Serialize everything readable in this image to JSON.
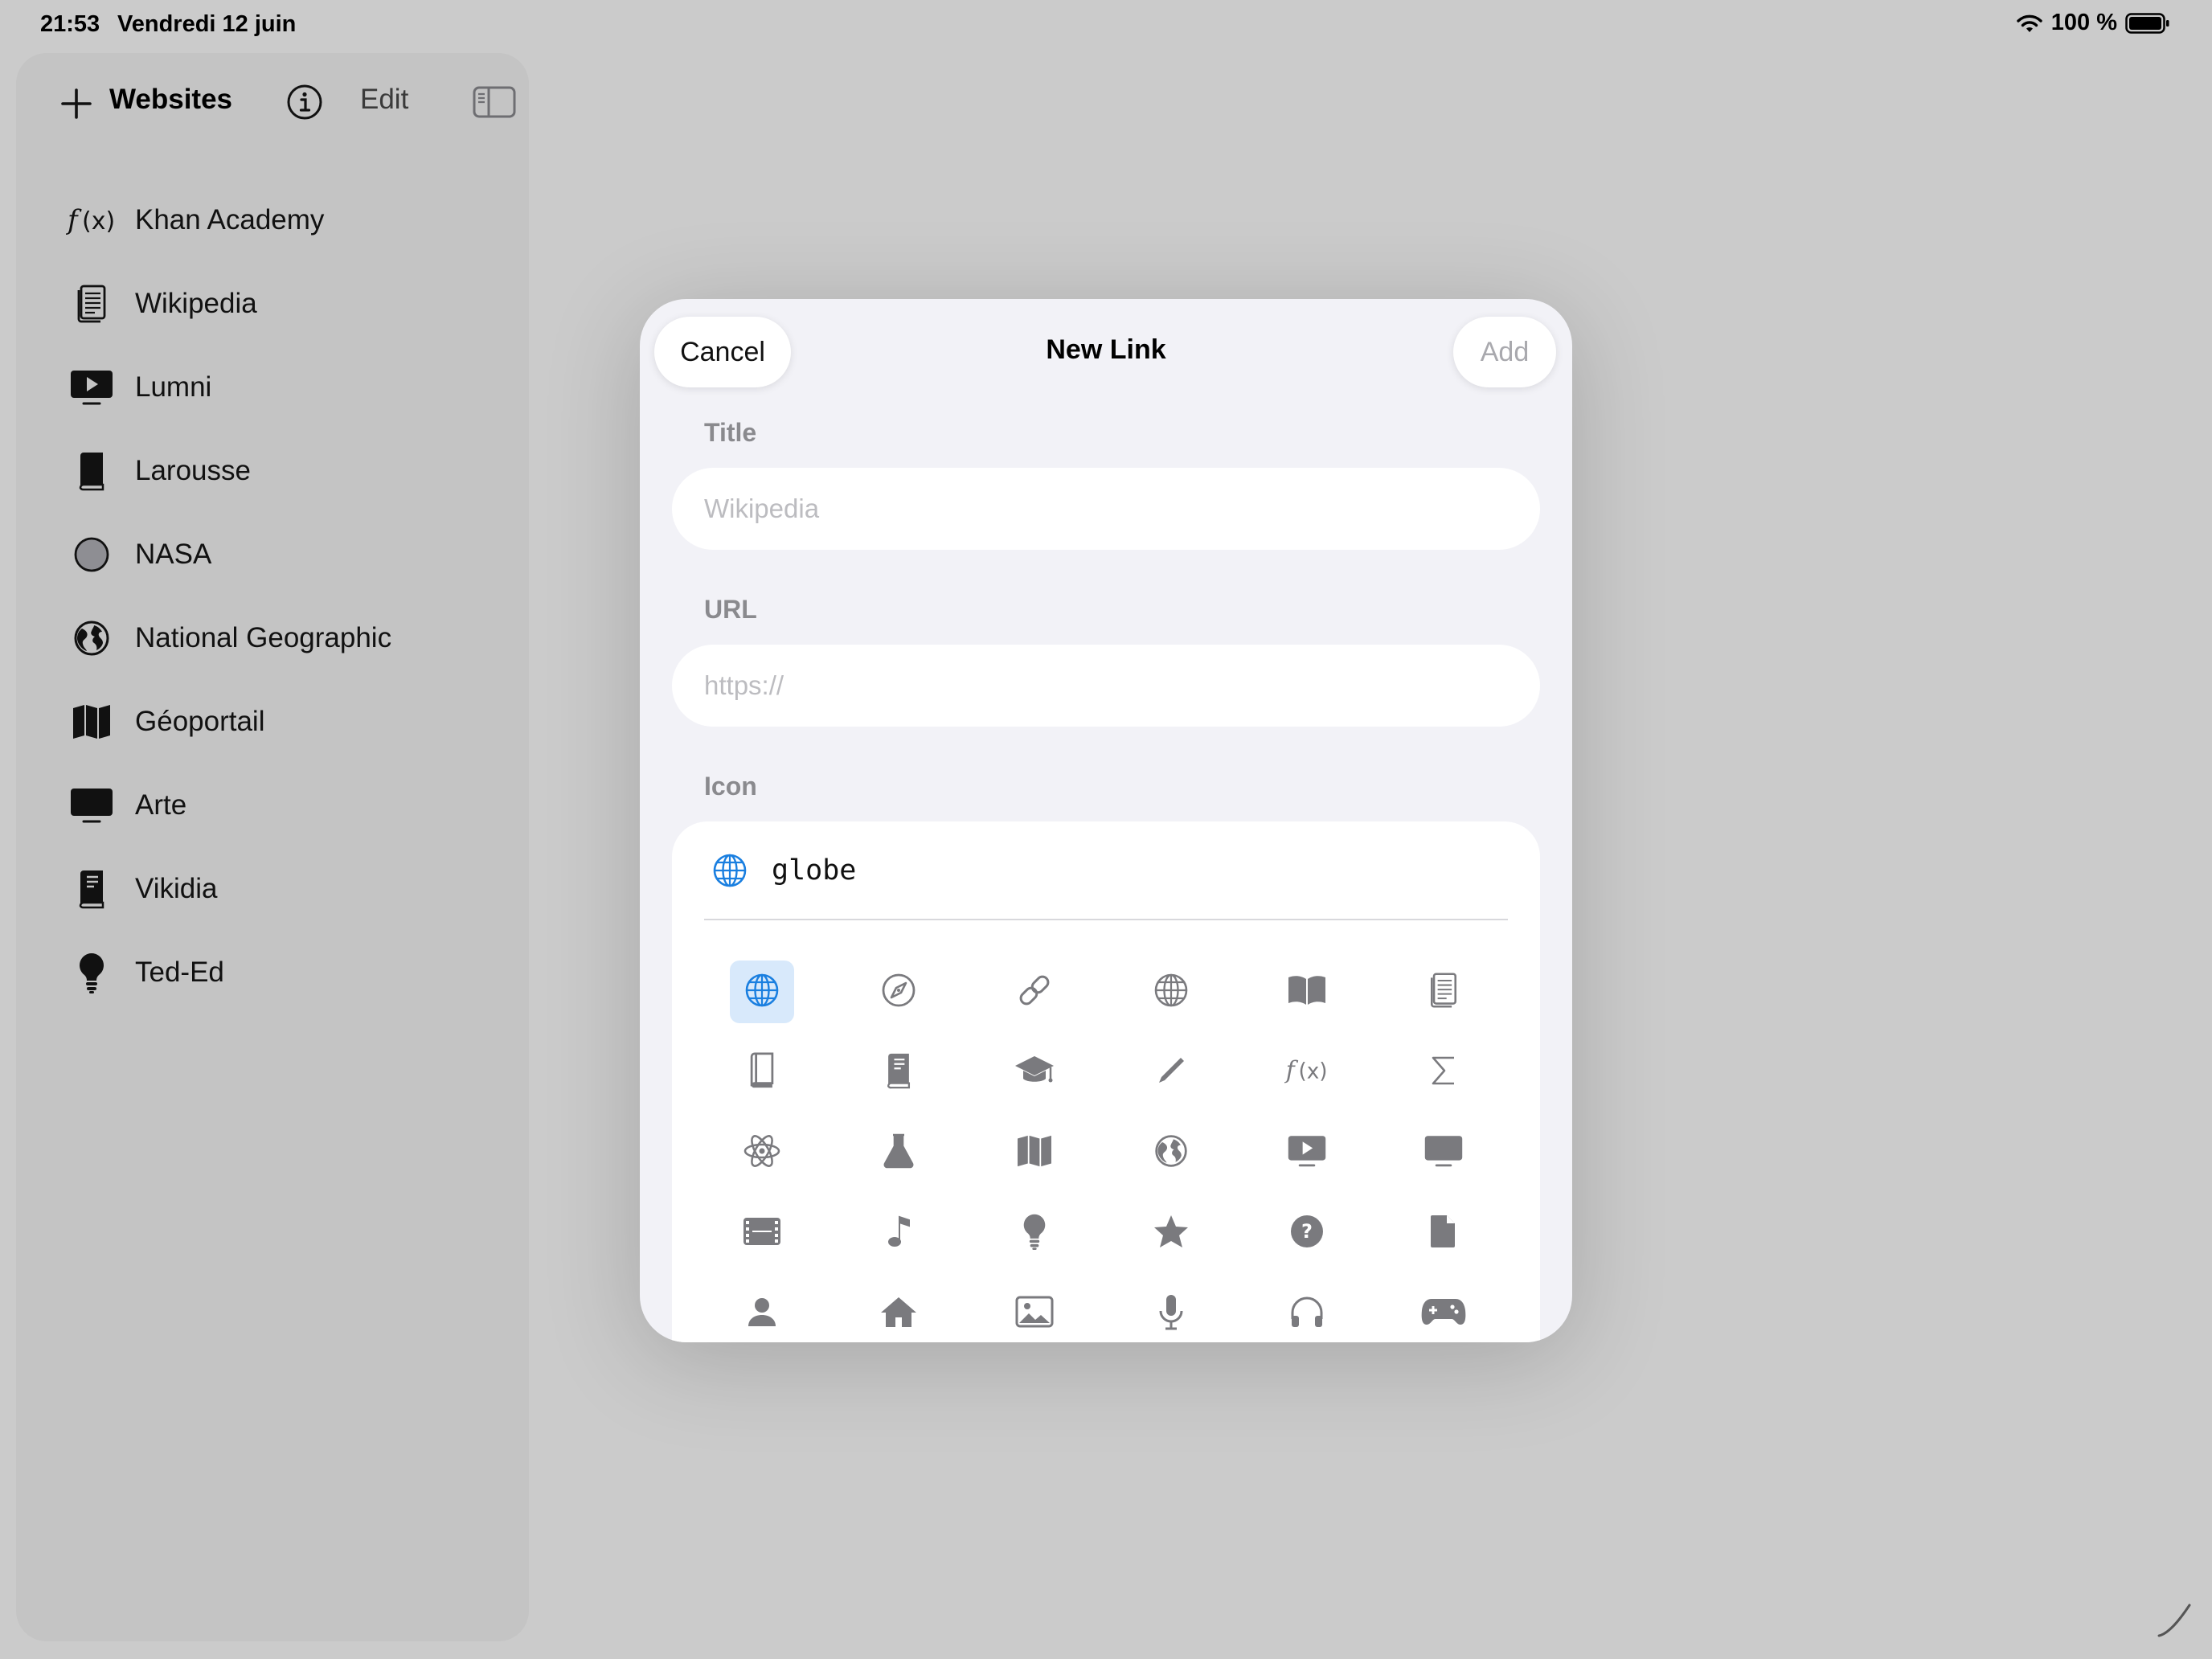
{
  "status_bar": {
    "time": "21:53",
    "date": "Vendredi 12 juin",
    "battery": "100 %"
  },
  "sidebar": {
    "title": "Websites",
    "edit_label": "Edit",
    "items": [
      {
        "label": "Khan Academy",
        "icon": "function-icon"
      },
      {
        "label": "Wikipedia",
        "icon": "document-icon"
      },
      {
        "label": "Lumni",
        "icon": "play-tv-icon"
      },
      {
        "label": "Larousse",
        "icon": "book-icon"
      },
      {
        "label": "NASA",
        "icon": "circle-icon"
      },
      {
        "label": "National Geographic",
        "icon": "earth-icon"
      },
      {
        "label": "Géoportail",
        "icon": "map-icon"
      },
      {
        "label": "Arte",
        "icon": "tv-icon"
      },
      {
        "label": "Vikidia",
        "icon": "closed-book-icon"
      },
      {
        "label": "Ted-Ed",
        "icon": "lightbulb-icon"
      }
    ]
  },
  "modal": {
    "title": "New Link",
    "cancel_label": "Cancel",
    "add_label": "Add",
    "title_section": {
      "label": "Title",
      "placeholder": "Wikipedia",
      "value": ""
    },
    "url_section": {
      "label": "URL",
      "placeholder": "https://",
      "value": ""
    },
    "icon_section": {
      "label": "Icon",
      "selected_name": "globe",
      "grid": [
        [
          "globe",
          "compass",
          "link",
          "globe-wire",
          "book-open",
          "document"
        ],
        [
          "book",
          "book-closed",
          "graduation-cap",
          "pencil",
          "function",
          "sigma"
        ],
        [
          "atom",
          "flask",
          "map",
          "earth",
          "play-tv",
          "tv"
        ],
        [
          "film",
          "music-note",
          "lightbulb",
          "star",
          "question-circle",
          "doc-fill"
        ],
        [
          "person",
          "house",
          "photo",
          "microphone",
          "headphones",
          "gamecontroller"
        ]
      ]
    }
  },
  "colors": {
    "accent": "#1a7fe0",
    "selected_bg": "#d8e9fb",
    "icon_gray": "#7a7a7e",
    "background": "#cbcbcb"
  }
}
